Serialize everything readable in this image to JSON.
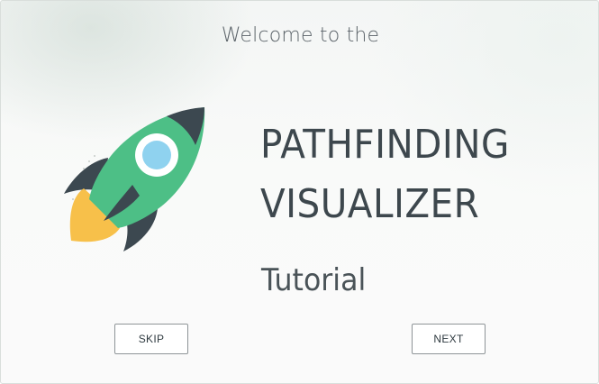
{
  "modal": {
    "welcome_text": "Welcome to the",
    "title_line_1": "PATHFINDING",
    "title_line_2": "VISUALIZER",
    "subtitle": "Tutorial",
    "rocket_icon": "rocket-icon",
    "skip_label": "SKIP",
    "next_label": "NEXT"
  },
  "colors": {
    "rocket_body": "#4dbf86",
    "rocket_fins": "#3c4850",
    "rocket_window": "#ffffff",
    "rocket_glass": "#8fd2ef",
    "rocket_flame": "#f7c04a",
    "title_text": "#3d474d"
  }
}
